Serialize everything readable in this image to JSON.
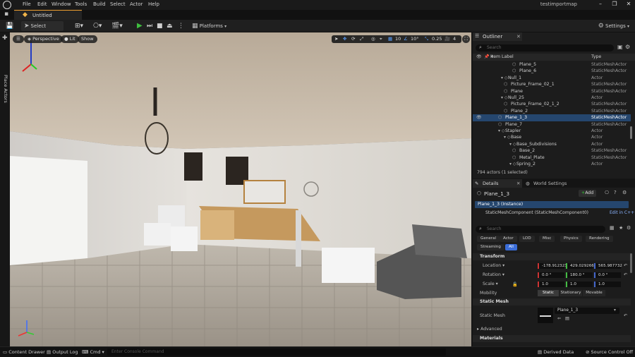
{
  "app": {
    "menus": [
      "File",
      "Edit",
      "Window",
      "Tools",
      "Build",
      "Select",
      "Actor",
      "Help"
    ],
    "project_name": "testimportmap",
    "level_tab": "Untitled"
  },
  "toolbar": {
    "select_mode": "Select Mode",
    "platforms": "Platforms",
    "settings": "Settings"
  },
  "left_strip": {
    "label": "Place Actors"
  },
  "viewport": {
    "perspective": "Perspective",
    "lit": "Lit",
    "show": "Show",
    "grid_snap": "10",
    "rotation_snap": "10°",
    "scale_snap": "0.25",
    "camera_speed": "4"
  },
  "outliner": {
    "tab": "Outliner",
    "search_placeholder": "Search",
    "col_label": "Item Label",
    "col_type": "Type",
    "rows": [
      {
        "name": "Plane_5",
        "type": "StaticMeshActor",
        "indent": 66,
        "icon": "mesh"
      },
      {
        "name": "Plane_6",
        "type": "StaticMeshActor",
        "indent": 66,
        "icon": "mesh"
      },
      {
        "name": "Null_1",
        "type": "Actor",
        "indent": 50,
        "icon": "folder"
      },
      {
        "name": "Picture_Frame_02_1",
        "type": "StaticMeshActor",
        "indent": 54,
        "icon": "mesh"
      },
      {
        "name": "Plane",
        "type": "StaticMeshActor",
        "indent": 54,
        "icon": "mesh"
      },
      {
        "name": "Null_25",
        "type": "Actor",
        "indent": 50,
        "icon": "folder"
      },
      {
        "name": "Picture_Frame_02_1_2",
        "type": "StaticMeshActor",
        "indent": 54,
        "icon": "mesh"
      },
      {
        "name": "Plane_2",
        "type": "StaticMeshActor",
        "indent": 54,
        "icon": "mesh"
      },
      {
        "name": "Plane_1_3",
        "type": "StaticMeshActor",
        "indent": 46,
        "icon": "mesh",
        "selected": true
      },
      {
        "name": "Plane_7",
        "type": "StaticMeshActor",
        "indent": 46,
        "icon": "mesh"
      },
      {
        "name": "Stapler",
        "type": "Actor",
        "indent": 46,
        "icon": "folder"
      },
      {
        "name": "Base",
        "type": "Actor",
        "indent": 54,
        "icon": "folder"
      },
      {
        "name": "Base_Subdivisions",
        "type": "Actor",
        "indent": 62,
        "icon": "folder"
      },
      {
        "name": "Base_2",
        "type": "StaticMeshActor",
        "indent": 66,
        "icon": "mesh"
      },
      {
        "name": "Metal_Plate",
        "type": "StaticMeshActor",
        "indent": 66,
        "icon": "mesh"
      },
      {
        "name": "Spring_2",
        "type": "Actor",
        "indent": 62,
        "icon": "folder"
      }
    ],
    "actor_count": "794 actors (1 selected)"
  },
  "details": {
    "tab": "Details",
    "world_tab": "World Settings",
    "object_name": "Plane_1_3",
    "add_label": "Add",
    "instance_label": "Plane_1_3 (Instance)",
    "component_label": "StaticMeshComponent (StaticMeshComponent0)",
    "edit_cpp": "Edit in C++",
    "search_placeholder": "Search",
    "filters_row1": [
      "General",
      "Actor",
      "LOD",
      "Misc",
      "Physics",
      "Rendering"
    ],
    "filters_row2": [
      "Streaming",
      "All"
    ],
    "transform_header": "Transform",
    "location_label": "Location",
    "rotation_label": "Rotation",
    "scale_label": "Scale",
    "location": [
      "-178.912323",
      "429.029266",
      "565.987732"
    ],
    "rotation": [
      "0.0 °",
      "180.0 °",
      "0.0 °"
    ],
    "scale": [
      "1.0",
      "1.0",
      "1.0"
    ],
    "mobility_label": "Mobility",
    "mobility_options": [
      "Static",
      "Stationary",
      "Movable"
    ],
    "static_mesh_header": "Static Mesh",
    "static_mesh_label": "Static Mesh",
    "static_mesh_value": "Plane_1_3",
    "advanced_label": "Advanced",
    "materials_header": "Materials"
  },
  "statusbar": {
    "content_drawer": "Content Drawer",
    "output_log": "Output Log",
    "cmd": "Cmd",
    "console_placeholder": "Enter Console Command",
    "derived_data": "Derived Data",
    "source_control": "Source Control Off"
  },
  "colors": {
    "accent_blue": "#25466e",
    "tab_accent": "#f0a030",
    "play_green": "#3fbf3f"
  }
}
